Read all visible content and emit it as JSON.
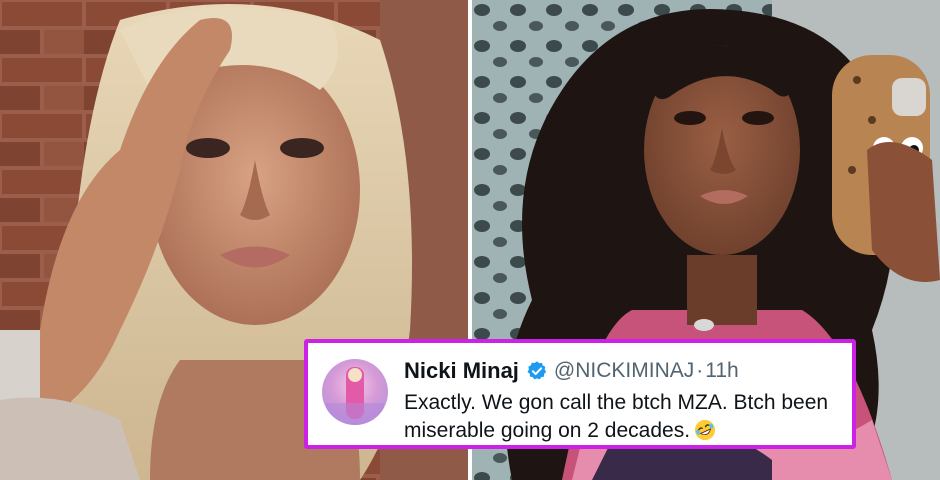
{
  "tweet": {
    "display_name": "Nicki Minaj",
    "handle": "@NICKIMINAJ",
    "separator": "·",
    "time": "11h",
    "text_line1": "Exactly. We gon call the btch MZA. Btch been",
    "text_line2": "miserable going on 2 decades.",
    "emoji": "rolling-on-floor-laughing",
    "verified": true
  },
  "colors": {
    "card_border": "#cc22e8",
    "verified_badge": "#1d9bf0",
    "handle_text": "#536471"
  }
}
